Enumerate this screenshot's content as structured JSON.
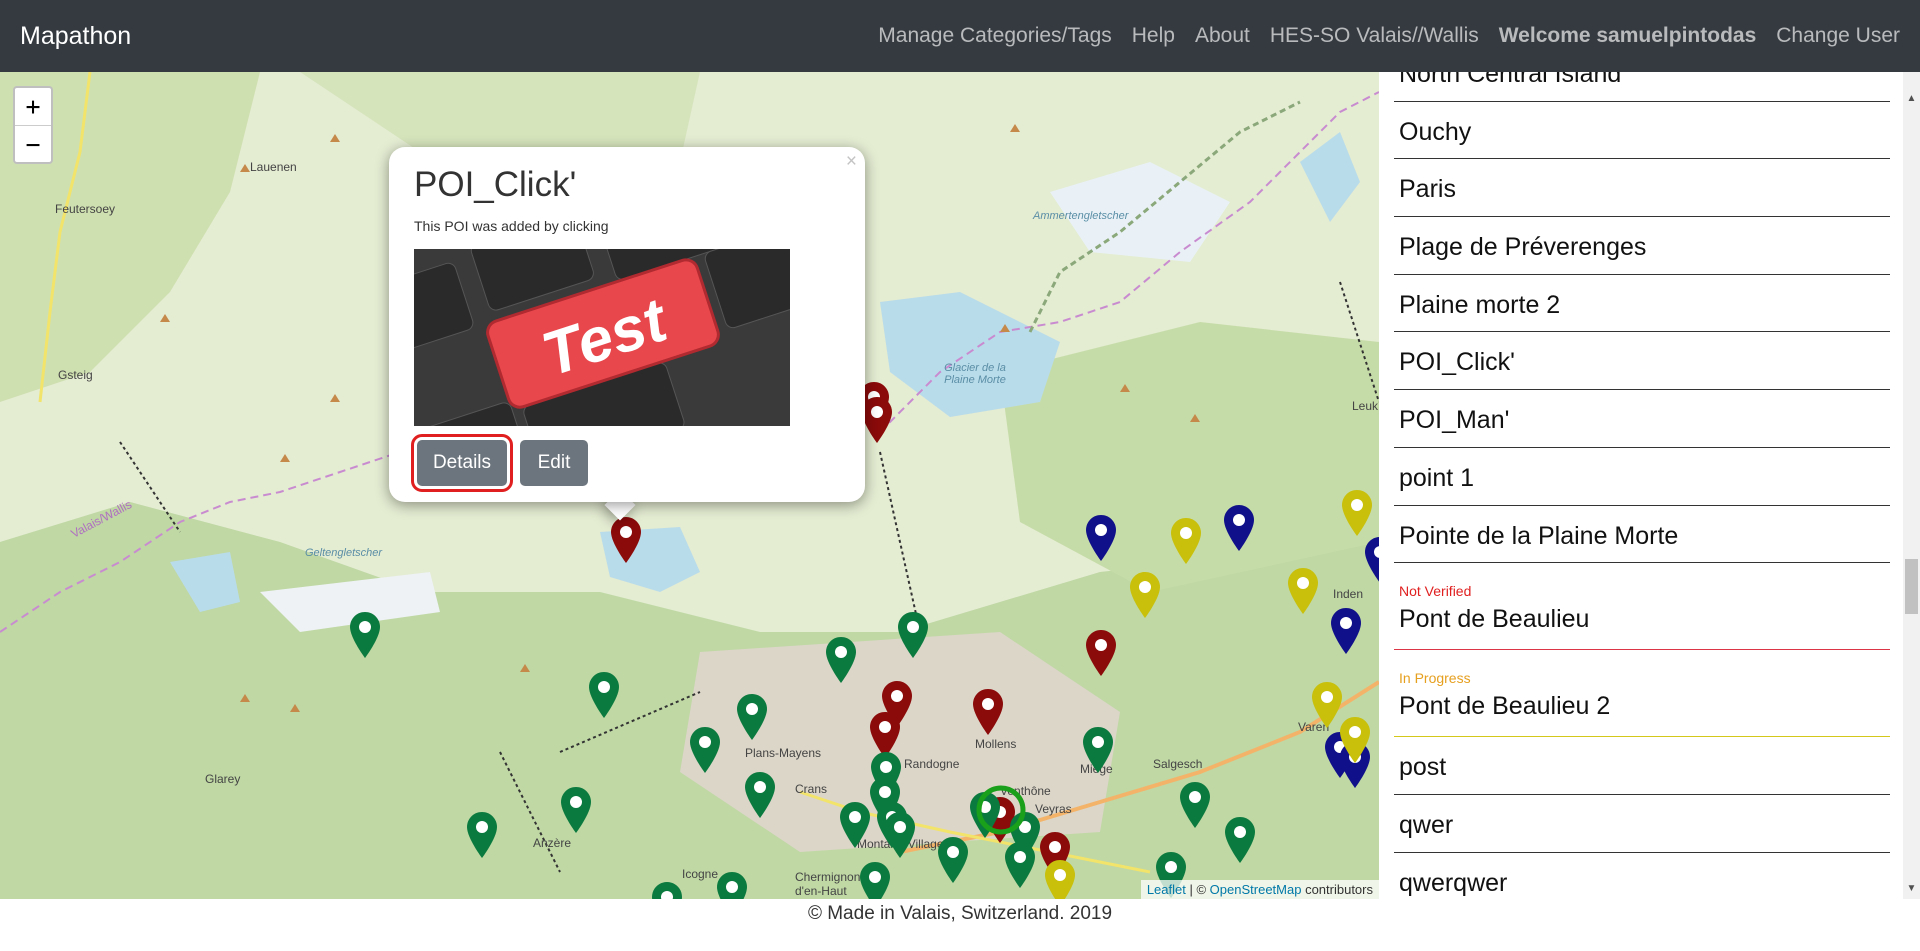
{
  "navbar": {
    "brand": "Mapathon",
    "links": [
      "Manage Categories/Tags",
      "Help",
      "About",
      "HES-SO Valais//Wallis"
    ],
    "welcome": "Welcome samuelpintodas",
    "change_user": "Change User"
  },
  "map": {
    "zoom_in": "+",
    "zoom_out": "−",
    "labels": [
      "Lauenen",
      "Feutersoey",
      "Gsteig",
      "Ammertengletscher",
      "Glacier de la Plaine Morte",
      "Geltengletscher",
      "Valais/Wallis",
      "Plans-Mayens",
      "Crans",
      "Randogne",
      "Mollens",
      "Miège",
      "Salgesch",
      "Glarey",
      "Anzère",
      "Icogne",
      "Chermignon d'en-Haut",
      "Montana-Village",
      "Venthône",
      "Veyras",
      "Inden",
      "Varen",
      "Leuk"
    ],
    "attribution": {
      "leaflet": "Leaflet",
      "sep": " | © ",
      "osm": "OpenStreetMap",
      "contrib": " contributors"
    }
  },
  "popup": {
    "close": "×",
    "title": "POI_Click'",
    "description": "This POI was added by clicking",
    "image_text": "Test",
    "details_label": "Details",
    "edit_label": "Edit"
  },
  "list": {
    "items": [
      {
        "name": "North Central Island",
        "status": ""
      },
      {
        "name": "Ouchy",
        "status": ""
      },
      {
        "name": "Paris",
        "status": ""
      },
      {
        "name": "Plage de Préverenges",
        "status": ""
      },
      {
        "name": "Plaine morte 2",
        "status": ""
      },
      {
        "name": "POI_Click'",
        "status": ""
      },
      {
        "name": "POI_Man'",
        "status": ""
      },
      {
        "name": "point 1",
        "status": ""
      },
      {
        "name": "Pointe de la Plaine Morte",
        "status": ""
      },
      {
        "name": "Pont de Beaulieu",
        "status": "Not Verified"
      },
      {
        "name": "Pont de Beaulieu 2",
        "status": "In Progress"
      },
      {
        "name": "post",
        "status": ""
      },
      {
        "name": "qwer",
        "status": ""
      },
      {
        "name": "qwerqwer",
        "status": ""
      }
    ]
  },
  "footer": {
    "text": "© Made in Valais, Switzerland. 2019"
  },
  "colors": {
    "navbar": "#343a40",
    "marker_green": "#0b7a3e",
    "marker_red": "#8b0a0a",
    "marker_blue": "#10108a",
    "marker_yellow": "#c8c00a",
    "not_verified": "#e02020",
    "in_progress": "#e6a020"
  }
}
